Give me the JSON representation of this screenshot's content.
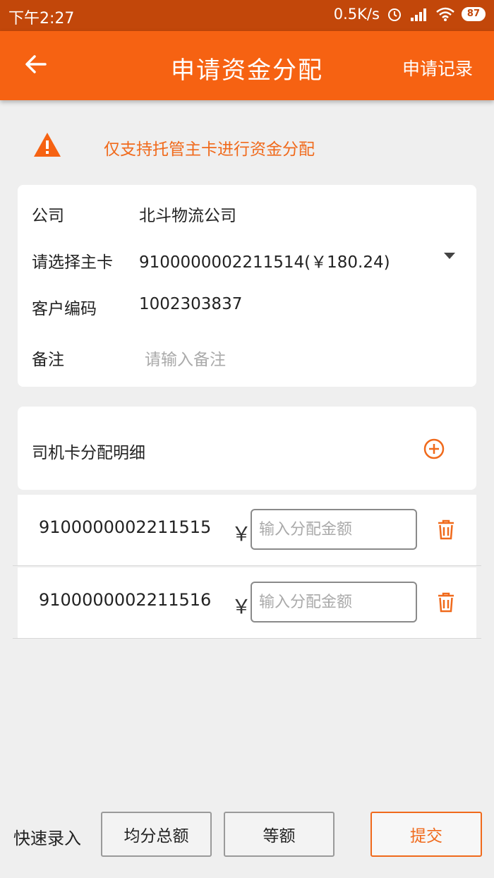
{
  "status_bar": {
    "time": "下午2:27",
    "net_speed": "0.5K/s",
    "battery": "87"
  },
  "header": {
    "title": "申请资金分配",
    "records_link": "申请记录"
  },
  "notice": {
    "text": "仅支持托管主卡进行资金分配"
  },
  "form": {
    "company_label": "公司",
    "company_value": "北斗物流公司",
    "main_card_label": "请选择主卡",
    "main_card_value": "9100000002211514(￥180.24)",
    "customer_code_label": "客户编码",
    "customer_code_value": "1002303837",
    "remark_label": "备注",
    "remark_placeholder": "请输入备注"
  },
  "detail": {
    "title": "司机卡分配明细",
    "rows": [
      {
        "card_no": "9100000002211515",
        "currency": "￥",
        "amount_placeholder": "输入分配金额"
      },
      {
        "card_no": "9100000002211516",
        "currency": "￥",
        "amount_placeholder": "输入分配金额"
      }
    ]
  },
  "bottom": {
    "quick_label": "快速录入",
    "avg_button": "均分总额",
    "equal_button": "等额",
    "submit_button": "提交"
  },
  "colors": {
    "accent": "#f66212",
    "status_bar": "#c2470a",
    "warning_text": "#f06a1c"
  },
  "icons": [
    "back-arrow-icon",
    "alarm-icon",
    "signal-icon",
    "wifi-icon",
    "warning-icon",
    "dropdown-icon",
    "add-circle-icon",
    "trash-icon"
  ]
}
